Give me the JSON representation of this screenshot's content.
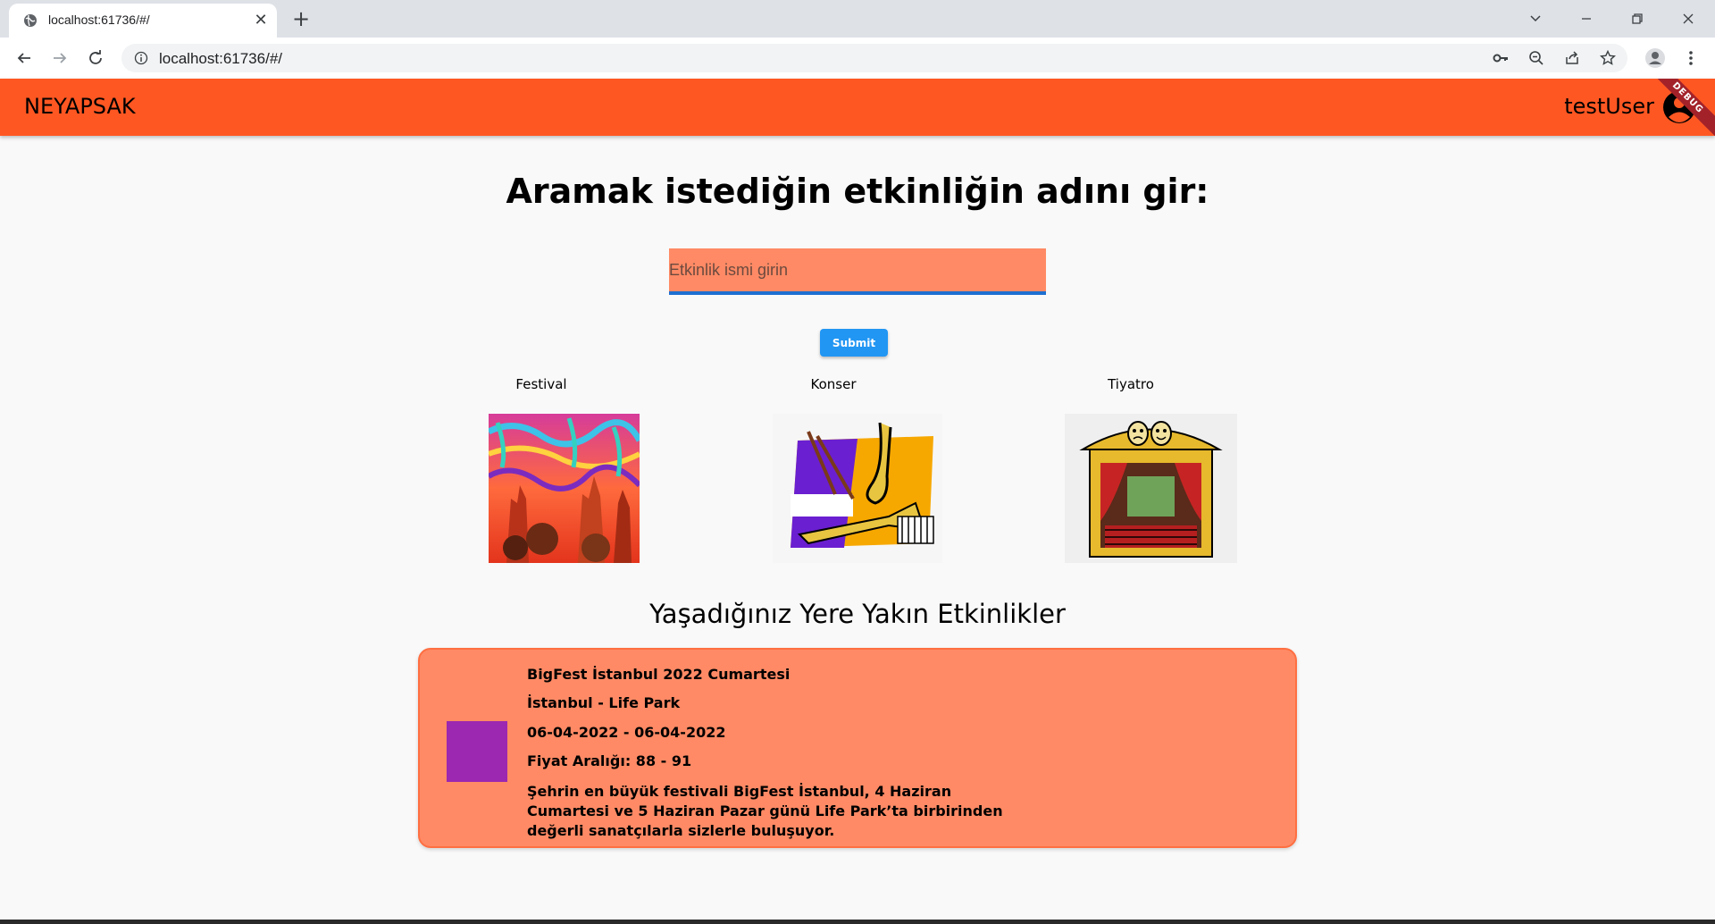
{
  "browser": {
    "tab_title": "localhost:61736/#/",
    "url": "localhost:61736/#/",
    "new_tab_symbol": "+",
    "close_tab_symbol": "✕"
  },
  "appbar": {
    "title": "NEYAPSAK",
    "user": "testUser",
    "debug_banner": "DEBUG",
    "color": "#ff5722"
  },
  "search": {
    "heading": "Aramak istediğin etkinliğin adını gir:",
    "placeholder": "Etkinlik ismi girin",
    "value": "",
    "submit_label": "Submit"
  },
  "categories": [
    {
      "label": "Festival",
      "icon": "festival-crowd-image"
    },
    {
      "label": "Konser",
      "icon": "concert-instruments-image"
    },
    {
      "label": "Tiyatro",
      "icon": "theater-stage-image"
    }
  ],
  "nearby": {
    "heading": "Yaşadığınız Yere Yakın Etkinlikler",
    "events": [
      {
        "title": "BigFest İstanbul 2022 Cumartesi",
        "location": "İstanbul  -  Life Park",
        "dates": "06-04-2022  -  06-04-2022",
        "price": "Fiyat Aralığı: 88  -  91",
        "description": "Şehrin en büyük festivali BigFest İstanbul, 4 Haziran Cumartesi ve 5 Haziran Pazar günü Life Park’ta birbirinden değerli sanatçılarla sizlerle buluşuyor.",
        "thumb_color": "#9c27b0"
      }
    ]
  }
}
